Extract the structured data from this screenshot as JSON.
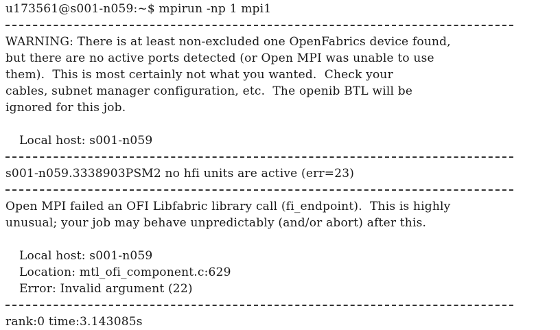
{
  "terminal": {
    "prompt": "u173561@s001-n059:~$ mpirun -np 1 mpi1",
    "warning_lines": [
      "WARNING: There is at least non-excluded one OpenFabrics device found,",
      "but there are no active ports detected (or Open MPI was unable to use",
      "them).  This is most certainly not what you wanted.  Check your",
      "cables, subnet manager configuration, etc.  The openib BTL will be",
      "ignored for this job."
    ],
    "warning_local_host": "Local host: s001-n059",
    "psm2_line": "s001-n059.3338903PSM2 no hfi units are active (err=23)",
    "ofi_lines": [
      "Open MPI failed an OFI Libfabric library call (fi_endpoint).  This is highly",
      "unusual; your job may behave unpredictably (and/or abort) after this."
    ],
    "ofi_local_host": "Local host: s001-n059",
    "ofi_location": "Location: mtl_ofi_component.c:629",
    "ofi_error": "Error: Invalid argument (22)",
    "result": "rank:0 time:3.143085s"
  }
}
